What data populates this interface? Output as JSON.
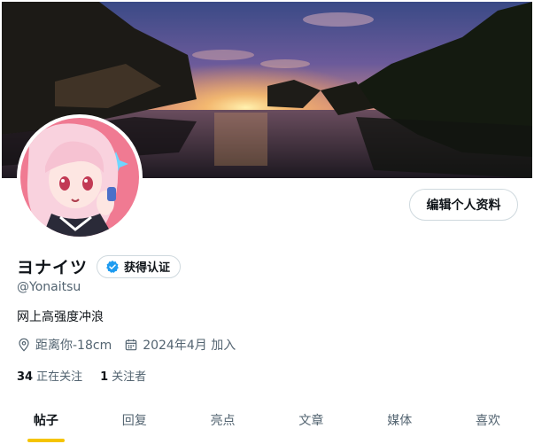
{
  "profile": {
    "display_name": "ヨナイツ",
    "verify_label": "获得认证",
    "handle": "@Yonaitsu",
    "bio": "网上高强度冲浪",
    "location": "距离你-18cm",
    "joined": "2024年4月 加入",
    "edit_button_label": "编辑个人资料"
  },
  "stats": {
    "following_count": "34",
    "following_label": "正在关注",
    "followers_count": "1",
    "followers_label": "关注者"
  },
  "tabs": [
    {
      "label": "帖子"
    },
    {
      "label": "回复"
    },
    {
      "label": "亮点"
    },
    {
      "label": "文章"
    },
    {
      "label": "媒体"
    },
    {
      "label": "喜欢"
    }
  ],
  "colors": {
    "accent_underline": "#f5c400",
    "verified_badge": "#1d9bf0"
  },
  "icons": {
    "verified": "verified-badge-icon",
    "location": "location-pin-icon",
    "calendar": "calendar-icon"
  }
}
